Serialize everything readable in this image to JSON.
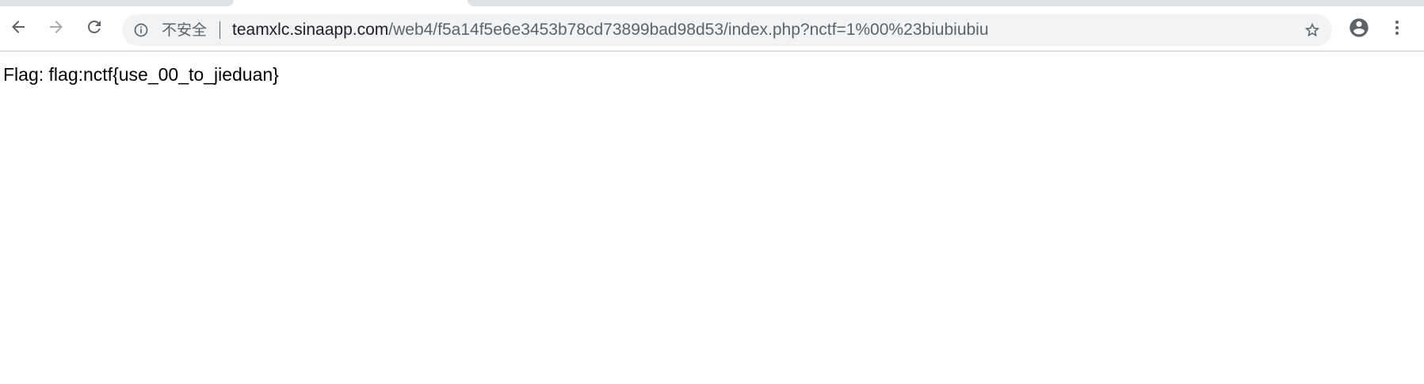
{
  "browser": {
    "security_label": "不安全",
    "url": {
      "host": "teamxlc.sinaapp.com",
      "path": "/web4/f5a14f5e6e3453b78cd73899bad98d53/index.php?nctf=1%00%23biubiubiu"
    },
    "icons": {
      "back": "back-arrow-icon",
      "forward": "forward-arrow-icon",
      "reload": "reload-icon",
      "info": "info-icon",
      "bookmark": "star-icon",
      "profile": "account-circle-icon",
      "menu": "more-vert-icon"
    },
    "colors": {
      "toolbar_icon": "#5f6368",
      "disabled_icon": "#a9aaac",
      "omnibox_bg": "#f1f3f4"
    }
  },
  "page": {
    "text": "Flag: flag:nctf{use_00_to_jieduan}"
  }
}
